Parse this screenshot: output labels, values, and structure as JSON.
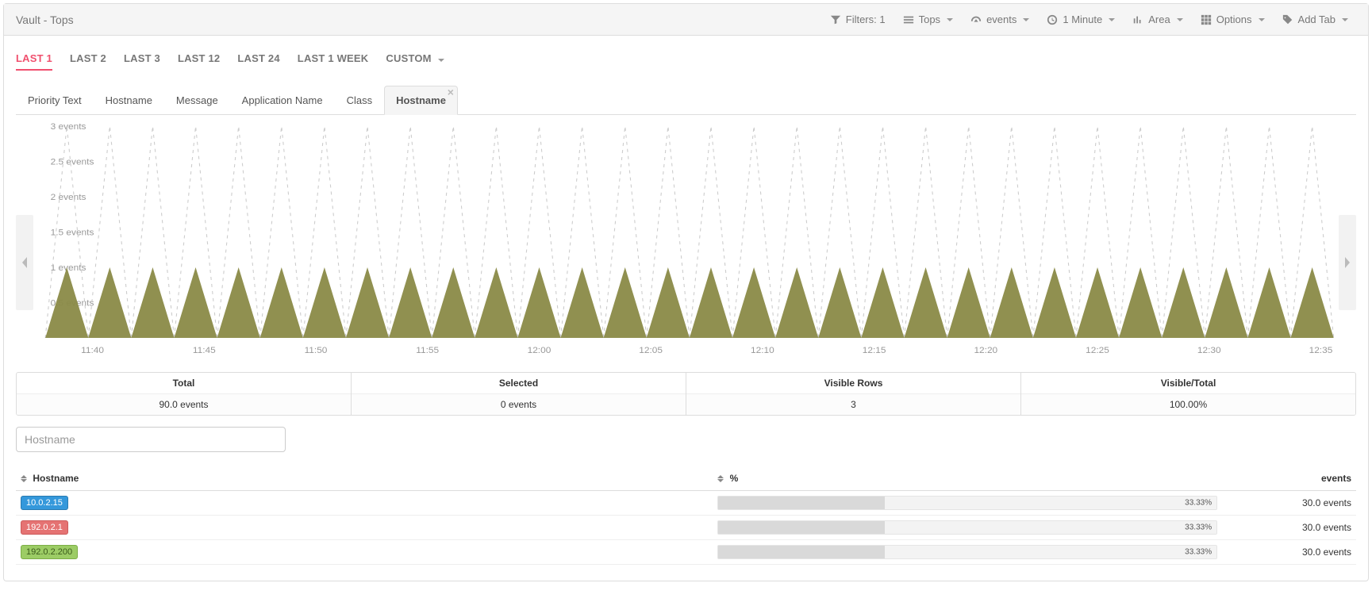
{
  "header": {
    "title": "Vault - Tops",
    "controls": {
      "filters_label": "Filters: 1",
      "tops_label": "Tops",
      "events_label": "events",
      "interval_label": "1 Minute",
      "chart_type_label": "Area",
      "options_label": "Options",
      "add_tab_label": "Add Tab"
    }
  },
  "time_tabs": {
    "items": [
      "LAST 1",
      "LAST 2",
      "LAST 3",
      "LAST 12",
      "LAST 24",
      "LAST 1 WEEK",
      "CUSTOM"
    ],
    "active_index": 0,
    "custom_has_caret": true
  },
  "field_tabs": {
    "items": [
      "Priority Text",
      "Hostname",
      "Message",
      "Application Name",
      "Class",
      "Hostname"
    ],
    "active_index": 5,
    "closable_active": true
  },
  "chart_data": {
    "type": "area",
    "ylabel": "",
    "ylim": [
      0,
      3
    ],
    "y_ticks": [
      {
        "v": 3,
        "label": "3 events"
      },
      {
        "v": 2.5,
        "label": "2.5 events"
      },
      {
        "v": 2,
        "label": "2 events"
      },
      {
        "v": 1.5,
        "label": "1.5 events"
      },
      {
        "v": 1,
        "label": "1 events"
      },
      {
        "v": 0.5,
        "label": "0.5 events"
      }
    ],
    "x_ticks": [
      "11:40",
      "11:45",
      "11:50",
      "11:55",
      "12:00",
      "12:05",
      "12:10",
      "12:15",
      "12:20",
      "12:25",
      "12:30",
      "12:35"
    ],
    "series": [
      {
        "name": "filled",
        "pattern": "sawtooth",
        "amplitude": 1,
        "baseline": 0,
        "teeth": 30
      },
      {
        "name": "dashed",
        "pattern": "sawtooth",
        "amplitude": 3,
        "baseline": 0,
        "teeth": 30
      }
    ],
    "colors": {
      "fill": "#8a8a47",
      "dash": "#cccccc"
    }
  },
  "summary": {
    "cells": [
      {
        "label": "Total",
        "value": "90.0 events"
      },
      {
        "label": "Selected",
        "value": "0 events"
      },
      {
        "label": "Visible Rows",
        "value": "3"
      },
      {
        "label": "Visible/Total",
        "value": "100.00%"
      }
    ]
  },
  "filter": {
    "placeholder": "Hostname"
  },
  "table": {
    "columns": {
      "hostname": "Hostname",
      "pct": "%",
      "events": "events"
    },
    "rows": [
      {
        "host": "10.0.2.15",
        "badge": "blue",
        "pct": 33.33,
        "pct_label": "33.33%",
        "events": "30.0 events"
      },
      {
        "host": "192.0.2.1",
        "badge": "red",
        "pct": 33.33,
        "pct_label": "33.33%",
        "events": "30.0 events"
      },
      {
        "host": "192.0.2.200",
        "badge": "green",
        "pct": 33.33,
        "pct_label": "33.33%",
        "events": "30.0 events"
      }
    ]
  }
}
